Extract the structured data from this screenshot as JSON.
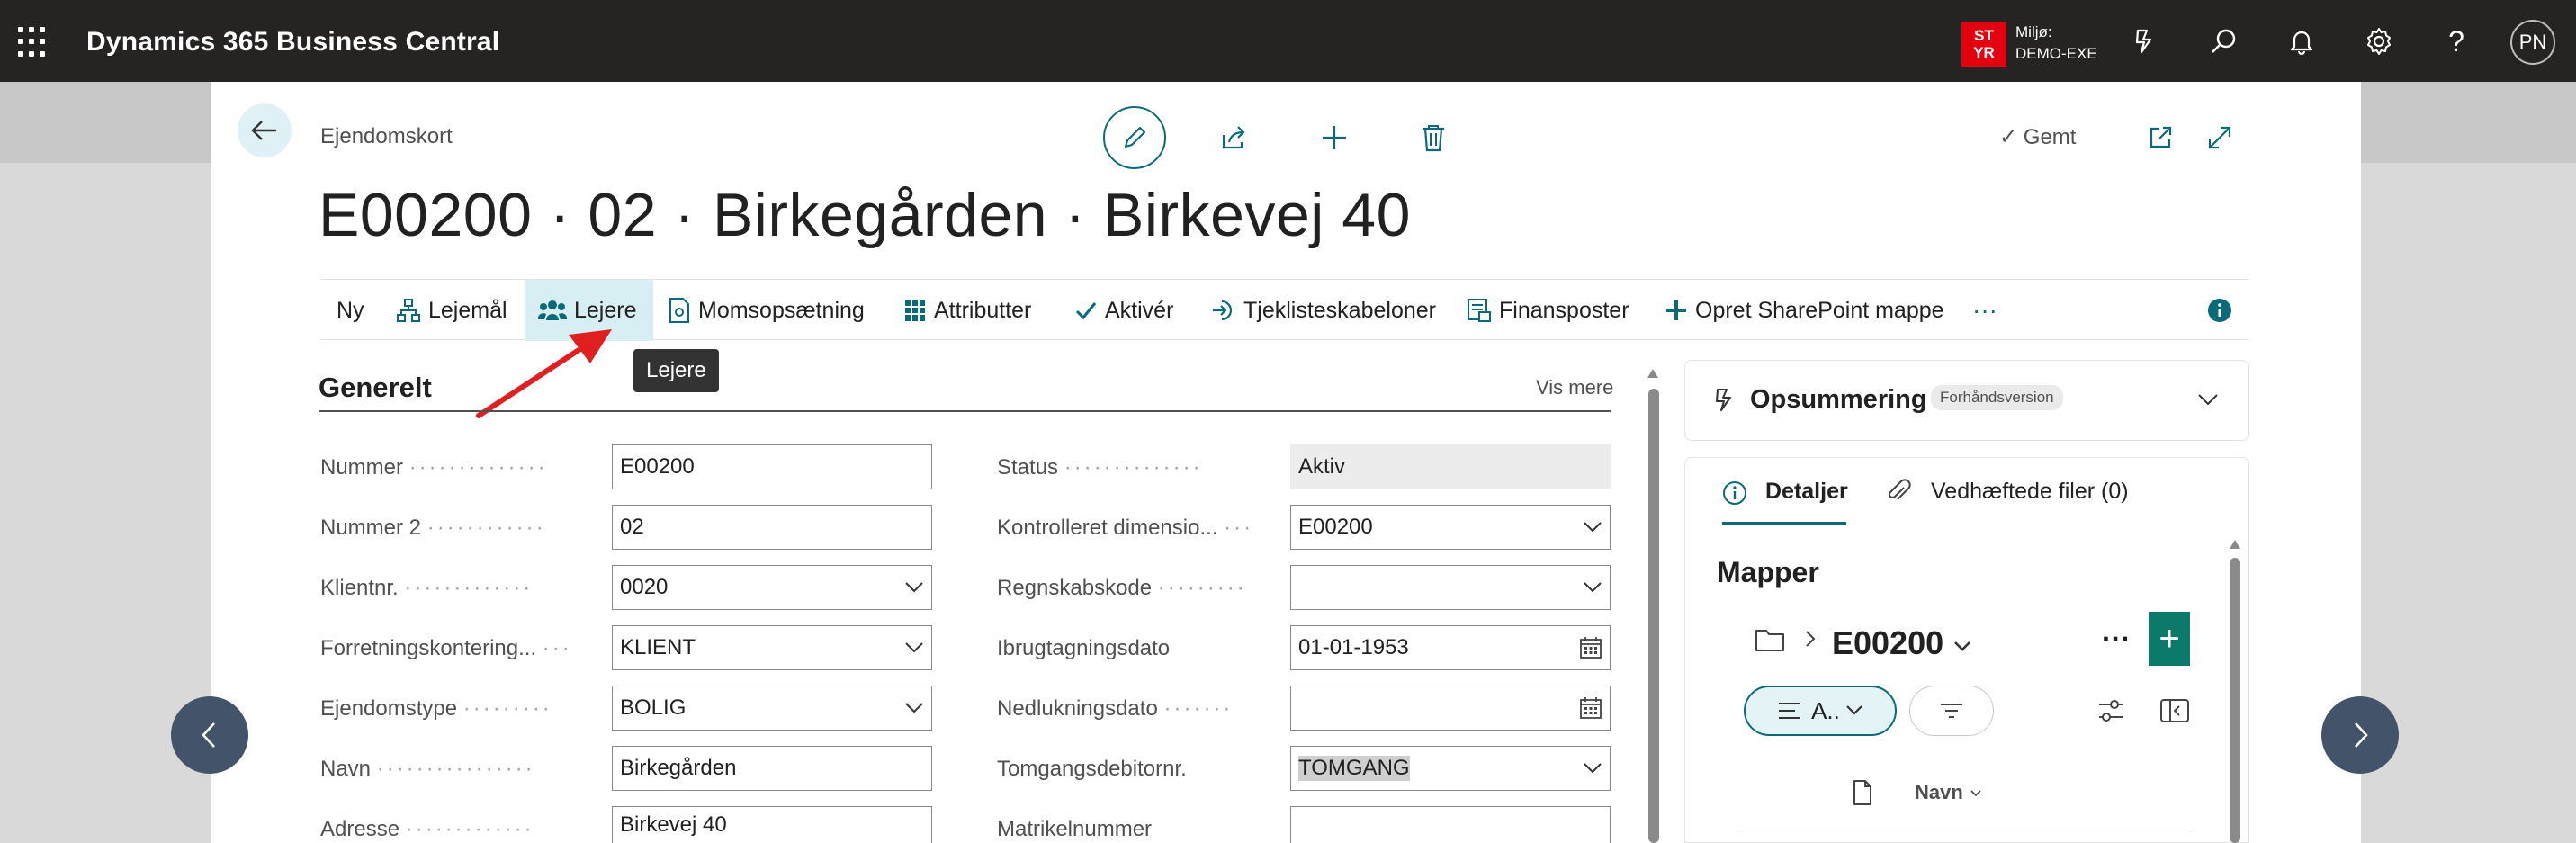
{
  "topbar": {
    "app_title": "Dynamics 365 Business Central",
    "env_badge_line1": "ST",
    "env_badge_line2": "YR",
    "env_label": "Miljø:",
    "env_name": "DEMO-EXE",
    "avatar_initials": "PN"
  },
  "header": {
    "breadcrumb": "Ejendomskort",
    "saved_label": "Gemt",
    "page_title": "E00200 · 02 · Birkegården · Birkevej 40"
  },
  "actionbar": {
    "items": [
      {
        "label": "Ny"
      },
      {
        "label": "Lejemål"
      },
      {
        "label": "Lejere"
      },
      {
        "label": "Momsopsætning"
      },
      {
        "label": "Attributter"
      },
      {
        "label": "Aktivér"
      },
      {
        "label": "Tjeklisteskabeloner"
      },
      {
        "label": "Finansposter"
      },
      {
        "label": "Opret SharePoint mappe"
      }
    ],
    "more": "···",
    "tooltip": "Lejere"
  },
  "section": {
    "title": "Generelt",
    "show_more": "Vis mere"
  },
  "fields_left": [
    {
      "label": "Nummer",
      "value": "E00200",
      "type": "text"
    },
    {
      "label": "Nummer 2",
      "value": "02",
      "type": "text"
    },
    {
      "label": "Klientnr.",
      "value": "0020",
      "type": "dropdown"
    },
    {
      "label": "Forretningskontering...",
      "value": "KLIENT",
      "type": "dropdown"
    },
    {
      "label": "Ejendomstype",
      "value": "BOLIG",
      "type": "dropdown"
    },
    {
      "label": "Navn",
      "value": "Birkegården",
      "type": "text"
    },
    {
      "label": "Adresse",
      "value": "Birkevej 40",
      "type": "text"
    }
  ],
  "fields_right": [
    {
      "label": "Status",
      "value": "Aktiv",
      "type": "readonly"
    },
    {
      "label": "Kontrolleret dimensio...",
      "value": "E00200",
      "type": "dropdown"
    },
    {
      "label": "Regnskabskode",
      "value": "",
      "type": "dropdown"
    },
    {
      "label": "Ibrugtagningsdato",
      "value": "01-01-1953",
      "type": "date"
    },
    {
      "label": "Nedlukningsdato",
      "value": "",
      "type": "date"
    },
    {
      "label": "Tomgangsdebitornr.",
      "value": "TOMGANG",
      "type": "dropdown"
    },
    {
      "label": "Matrikelnummer",
      "value": "",
      "type": "text"
    }
  ],
  "factbox": {
    "summary_title": "Opsummering",
    "preview_badge": "Forhåndsversion",
    "tab_details": "Detaljer",
    "tab_attachments": "Vedhæftede filer (0)",
    "mapper_title": "Mapper",
    "folder_name": "E00200",
    "more": "···",
    "plus": "+",
    "pill_label": "A..",
    "column_name": "Navn"
  },
  "colors": {
    "accent": "#0b6a7a",
    "topbar": "#252423",
    "env_badge": "#e3000f",
    "nav_circle": "#43546a"
  }
}
